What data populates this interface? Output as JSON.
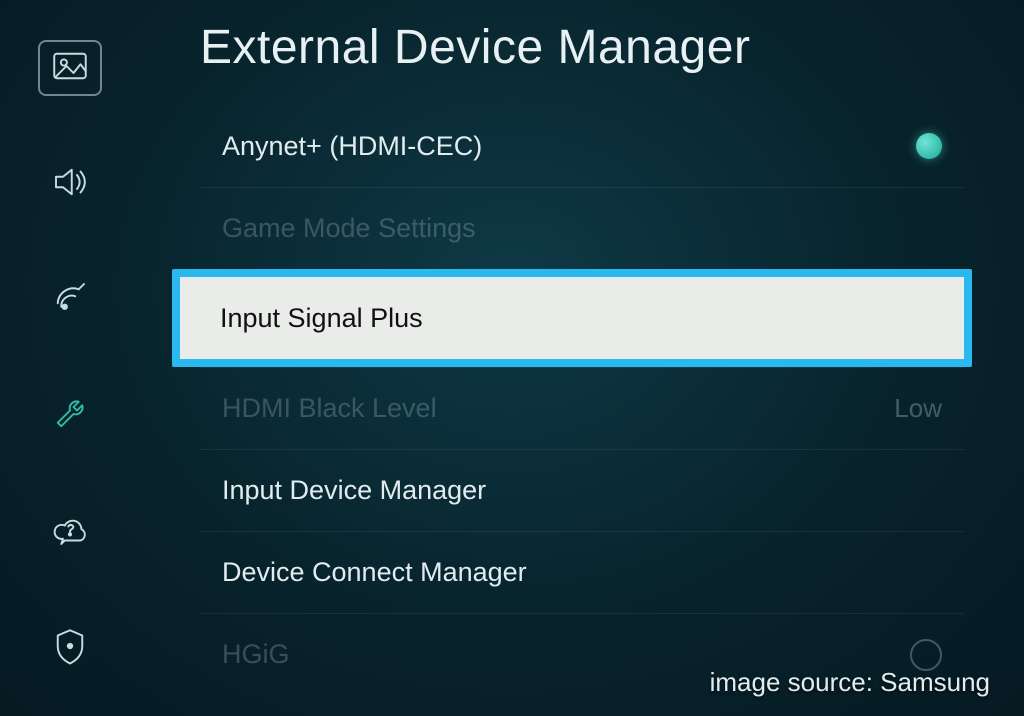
{
  "header": {
    "title": "External Device Manager"
  },
  "sidebar": {
    "items": [
      {
        "name": "picture",
        "active": true
      },
      {
        "name": "sound",
        "active": false
      },
      {
        "name": "broadcast",
        "active": false
      },
      {
        "name": "general",
        "active": false
      },
      {
        "name": "support",
        "active": false
      },
      {
        "name": "privacy",
        "active": false
      }
    ]
  },
  "menu": {
    "items": [
      {
        "label": "Anynet+ (HDMI-CEC)",
        "state": "enabled",
        "toggle": "on"
      },
      {
        "label": "Game Mode Settings",
        "state": "dim"
      },
      {
        "label": "Input Signal Plus",
        "state": "highlight"
      },
      {
        "label": "HDMI Black Level",
        "state": "dim",
        "value": "Low"
      },
      {
        "label": "Input Device Manager",
        "state": "enabled"
      },
      {
        "label": "Device Connect Manager",
        "state": "enabled"
      },
      {
        "label": "HGiG",
        "state": "dim",
        "toggle": "off"
      }
    ]
  },
  "caption": "image source: Samsung"
}
